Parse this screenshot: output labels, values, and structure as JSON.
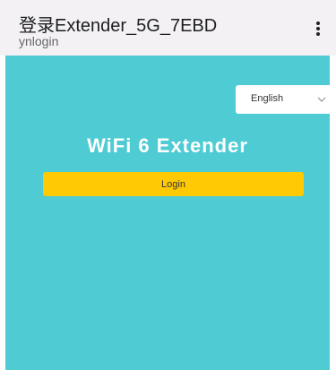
{
  "topbar": {
    "title": "登录Extender_5G_7EBD",
    "subtitle": "ynlogin",
    "menu_icon": "more-vertical-icon"
  },
  "main": {
    "language_select": {
      "value": "English",
      "icon": "chevron-down-icon"
    },
    "heading": "WiFi 6 Extender",
    "login_label": "Login"
  },
  "colors": {
    "topbar_bg": "#f3f1f4",
    "content_bg": "#4ecbd3",
    "button_bg": "#ffca04",
    "heading_text": "#ffffff"
  }
}
